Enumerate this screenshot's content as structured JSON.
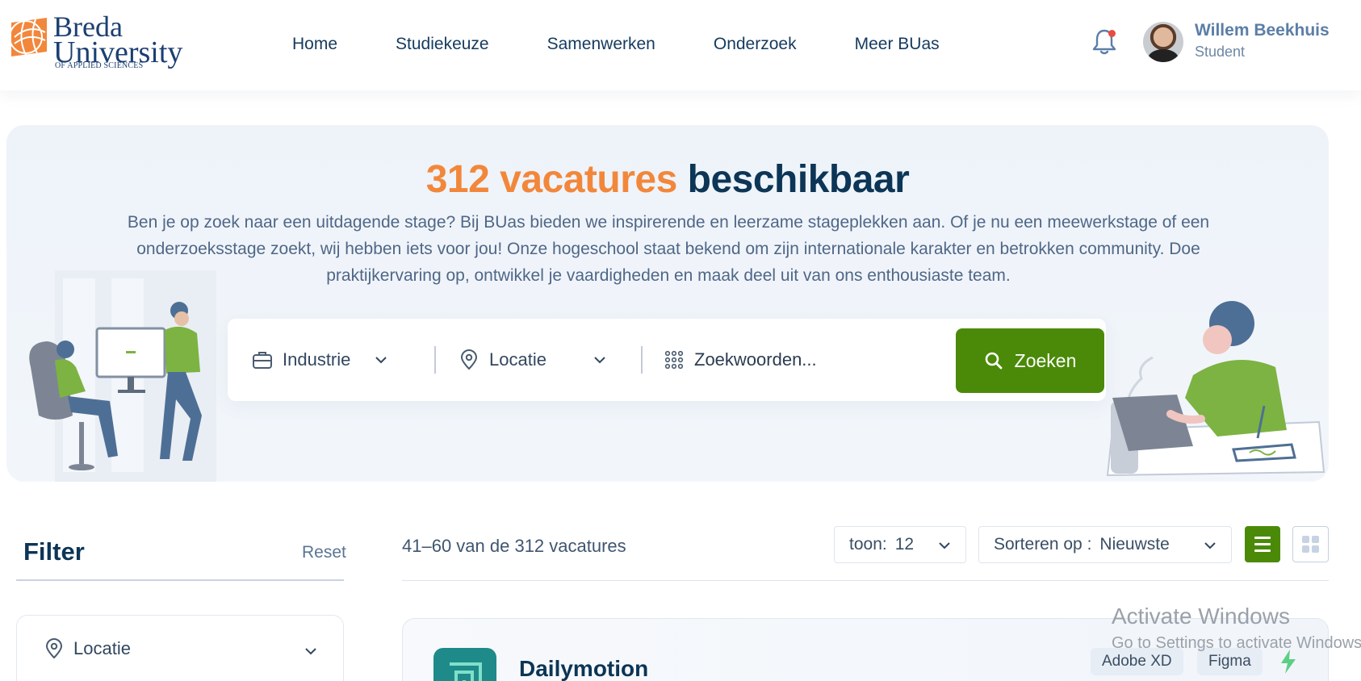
{
  "brand": {
    "name_line1": "Breda",
    "name_line2": "University",
    "tagline": "OF APPLIED SCIENCES",
    "logo_color": "#f2873b"
  },
  "nav": {
    "items": [
      {
        "label": "Home"
      },
      {
        "label": "Studiekeuze"
      },
      {
        "label": "Samenwerken"
      },
      {
        "label": "Onderzoek"
      },
      {
        "label": "Meer BUas"
      }
    ]
  },
  "user": {
    "name": "Willem Beekhuis",
    "role": "Student",
    "notification_icon": "bell-icon",
    "has_notification": true
  },
  "hero": {
    "title_highlight": "312 vacatures",
    "title_rest": "beschikbaar",
    "description": "Ben je op zoek naar een uitdagende stage? Bij BUas bieden we inspirerende en leerzame stageplekken aan. Of je nu een meewerkstage of een onderzoeksstage zoekt, wij hebben iets voor jou! Onze hogeschool staat bekend om zijn internationale karakter en betrokken community. Doe praktijkervaring op, ontwikkel je vaardigheden en maak deel uit van ons enthousiaste team."
  },
  "search": {
    "industry_label": "Industrie",
    "location_label": "Locatie",
    "keyword_placeholder": "Zoekwoorden...",
    "button_label": "Zoeken"
  },
  "filter": {
    "title": "Filter",
    "reset_label": "Reset",
    "location_label": "Locatie"
  },
  "results": {
    "count_text": "41–60 van de 312 vacatures",
    "show_label": "toon:",
    "show_value": "12",
    "sort_label": "Sorteren op :",
    "sort_value": "Nieuwste"
  },
  "vacancies": [
    {
      "company": "Dailymotion",
      "tags": [
        "Adobe XD",
        "Figma"
      ]
    }
  ],
  "colors": {
    "accent_orange": "#f2873b",
    "navy": "#0c3556",
    "green": "#4a8a08"
  },
  "os_overlay": {
    "line1": "Activate Windows",
    "line2": "Go to Settings to activate Windows."
  }
}
